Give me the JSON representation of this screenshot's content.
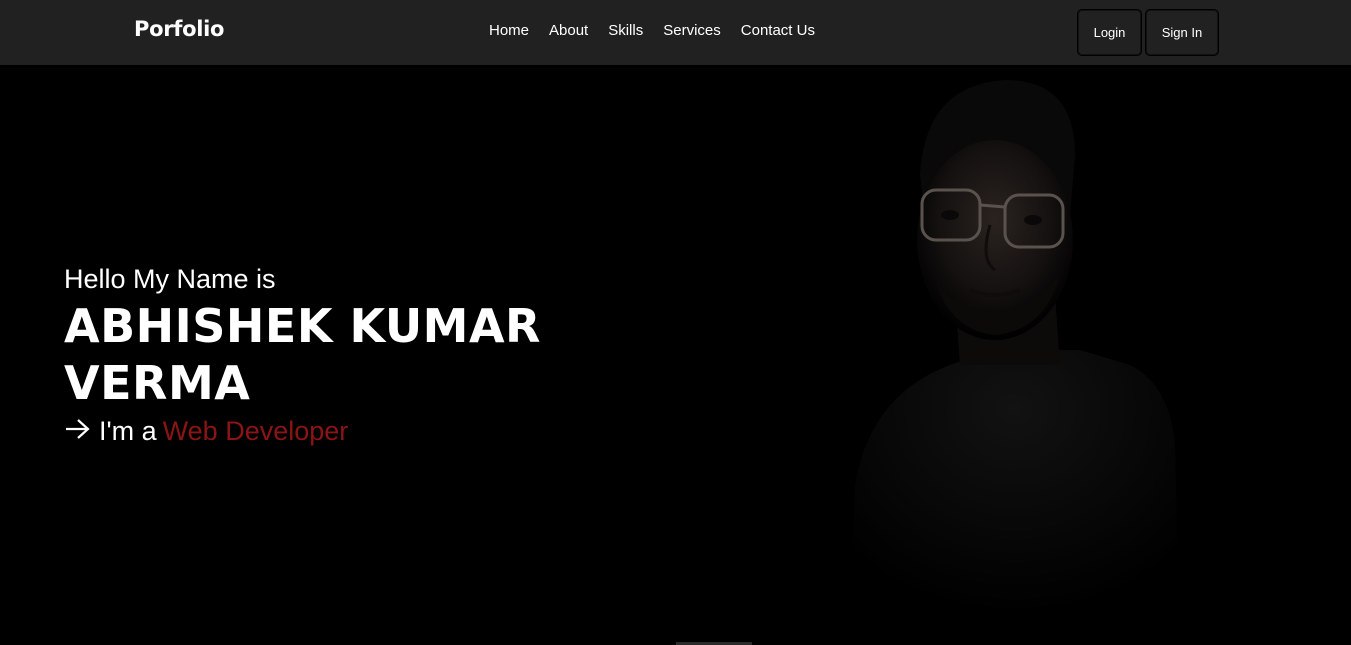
{
  "nav": {
    "brand": "Porfolio",
    "links": [
      "Home",
      "About",
      "Skills",
      "Services",
      "Contact Us"
    ],
    "login_label": "Login",
    "signin_label": "Sign In"
  },
  "hero": {
    "greeting": "Hello My Name is",
    "name": "ABHISHEK KUMAR VERMA",
    "role_prefix": "I'm a",
    "role_highlight": "Web Developer"
  },
  "colors": {
    "navbar_bg": "#212121",
    "hero_bg": "#000000",
    "accent": "#8b1414"
  },
  "icons": {
    "role_arrow": "arrow-right-icon"
  }
}
